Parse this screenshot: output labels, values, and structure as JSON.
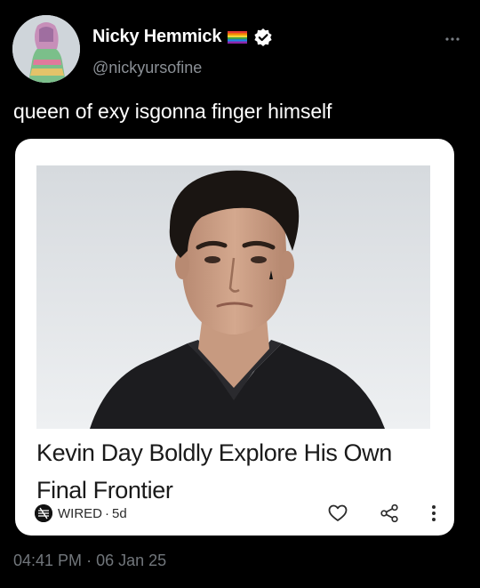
{
  "author": {
    "display_name": "Nicky Hemmick",
    "handle": "@nickyursofine"
  },
  "tweet": {
    "text": "queen of exy isgonna finger himself",
    "time": "04:41 PM",
    "separator": "·",
    "date": "06 Jan 25"
  },
  "card": {
    "headline": "Kevin Day Boldly Explore His Own Final Frontier",
    "source": "WIRED",
    "separator": "·",
    "age": "5d"
  },
  "icons": {
    "more": "more-horizontal-icon",
    "verified": "verified-badge-icon",
    "flag": "rainbow-flag-icon",
    "like": "heart-icon",
    "share": "share-icon",
    "menu": "vertical-dots-icon"
  },
  "colors": {
    "background": "#000000",
    "verified": "#ffffff",
    "handle": "#8b9096",
    "timestamp": "#71767b"
  }
}
